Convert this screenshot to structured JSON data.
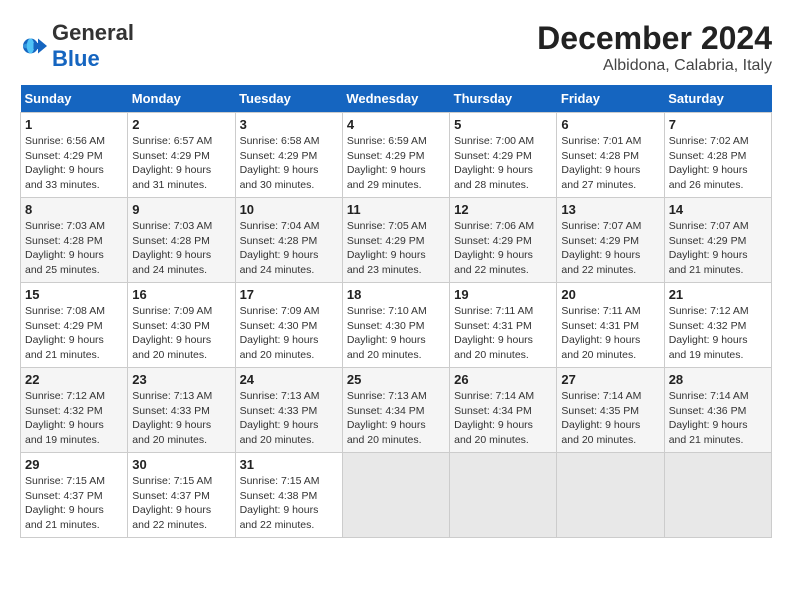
{
  "header": {
    "logo_general": "General",
    "logo_blue": "Blue",
    "month": "December 2024",
    "location": "Albidona, Calabria, Italy"
  },
  "days_of_week": [
    "Sunday",
    "Monday",
    "Tuesday",
    "Wednesday",
    "Thursday",
    "Friday",
    "Saturday"
  ],
  "weeks": [
    [
      {
        "day": "1",
        "info": "Sunrise: 6:56 AM\nSunset: 4:29 PM\nDaylight: 9 hours\nand 33 minutes."
      },
      {
        "day": "2",
        "info": "Sunrise: 6:57 AM\nSunset: 4:29 PM\nDaylight: 9 hours\nand 31 minutes."
      },
      {
        "day": "3",
        "info": "Sunrise: 6:58 AM\nSunset: 4:29 PM\nDaylight: 9 hours\nand 30 minutes."
      },
      {
        "day": "4",
        "info": "Sunrise: 6:59 AM\nSunset: 4:29 PM\nDaylight: 9 hours\nand 29 minutes."
      },
      {
        "day": "5",
        "info": "Sunrise: 7:00 AM\nSunset: 4:29 PM\nDaylight: 9 hours\nand 28 minutes."
      },
      {
        "day": "6",
        "info": "Sunrise: 7:01 AM\nSunset: 4:28 PM\nDaylight: 9 hours\nand 27 minutes."
      },
      {
        "day": "7",
        "info": "Sunrise: 7:02 AM\nSunset: 4:28 PM\nDaylight: 9 hours\nand 26 minutes."
      }
    ],
    [
      {
        "day": "8",
        "info": "Sunrise: 7:03 AM\nSunset: 4:28 PM\nDaylight: 9 hours\nand 25 minutes."
      },
      {
        "day": "9",
        "info": "Sunrise: 7:03 AM\nSunset: 4:28 PM\nDaylight: 9 hours\nand 24 minutes."
      },
      {
        "day": "10",
        "info": "Sunrise: 7:04 AM\nSunset: 4:28 PM\nDaylight: 9 hours\nand 24 minutes."
      },
      {
        "day": "11",
        "info": "Sunrise: 7:05 AM\nSunset: 4:29 PM\nDaylight: 9 hours\nand 23 minutes."
      },
      {
        "day": "12",
        "info": "Sunrise: 7:06 AM\nSunset: 4:29 PM\nDaylight: 9 hours\nand 22 minutes."
      },
      {
        "day": "13",
        "info": "Sunrise: 7:07 AM\nSunset: 4:29 PM\nDaylight: 9 hours\nand 22 minutes."
      },
      {
        "day": "14",
        "info": "Sunrise: 7:07 AM\nSunset: 4:29 PM\nDaylight: 9 hours\nand 21 minutes."
      }
    ],
    [
      {
        "day": "15",
        "info": "Sunrise: 7:08 AM\nSunset: 4:29 PM\nDaylight: 9 hours\nand 21 minutes."
      },
      {
        "day": "16",
        "info": "Sunrise: 7:09 AM\nSunset: 4:30 PM\nDaylight: 9 hours\nand 20 minutes."
      },
      {
        "day": "17",
        "info": "Sunrise: 7:09 AM\nSunset: 4:30 PM\nDaylight: 9 hours\nand 20 minutes."
      },
      {
        "day": "18",
        "info": "Sunrise: 7:10 AM\nSunset: 4:30 PM\nDaylight: 9 hours\nand 20 minutes."
      },
      {
        "day": "19",
        "info": "Sunrise: 7:11 AM\nSunset: 4:31 PM\nDaylight: 9 hours\nand 20 minutes."
      },
      {
        "day": "20",
        "info": "Sunrise: 7:11 AM\nSunset: 4:31 PM\nDaylight: 9 hours\nand 20 minutes."
      },
      {
        "day": "21",
        "info": "Sunrise: 7:12 AM\nSunset: 4:32 PM\nDaylight: 9 hours\nand 19 minutes."
      }
    ],
    [
      {
        "day": "22",
        "info": "Sunrise: 7:12 AM\nSunset: 4:32 PM\nDaylight: 9 hours\nand 19 minutes."
      },
      {
        "day": "23",
        "info": "Sunrise: 7:13 AM\nSunset: 4:33 PM\nDaylight: 9 hours\nand 20 minutes."
      },
      {
        "day": "24",
        "info": "Sunrise: 7:13 AM\nSunset: 4:33 PM\nDaylight: 9 hours\nand 20 minutes."
      },
      {
        "day": "25",
        "info": "Sunrise: 7:13 AM\nSunset: 4:34 PM\nDaylight: 9 hours\nand 20 minutes."
      },
      {
        "day": "26",
        "info": "Sunrise: 7:14 AM\nSunset: 4:34 PM\nDaylight: 9 hours\nand 20 minutes."
      },
      {
        "day": "27",
        "info": "Sunrise: 7:14 AM\nSunset: 4:35 PM\nDaylight: 9 hours\nand 20 minutes."
      },
      {
        "day": "28",
        "info": "Sunrise: 7:14 AM\nSunset: 4:36 PM\nDaylight: 9 hours\nand 21 minutes."
      }
    ],
    [
      {
        "day": "29",
        "info": "Sunrise: 7:15 AM\nSunset: 4:37 PM\nDaylight: 9 hours\nand 21 minutes."
      },
      {
        "day": "30",
        "info": "Sunrise: 7:15 AM\nSunset: 4:37 PM\nDaylight: 9 hours\nand 22 minutes."
      },
      {
        "day": "31",
        "info": "Sunrise: 7:15 AM\nSunset: 4:38 PM\nDaylight: 9 hours\nand 22 minutes."
      },
      {
        "day": "",
        "info": ""
      },
      {
        "day": "",
        "info": ""
      },
      {
        "day": "",
        "info": ""
      },
      {
        "day": "",
        "info": ""
      }
    ]
  ]
}
